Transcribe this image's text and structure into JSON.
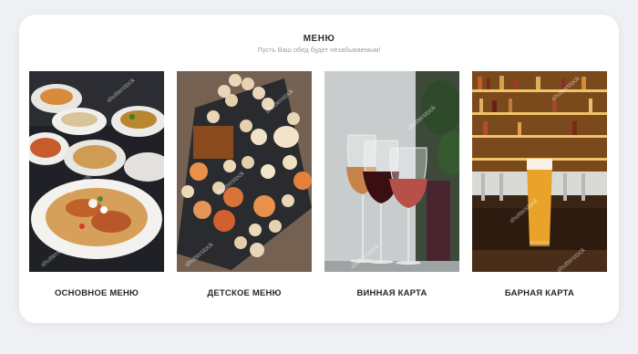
{
  "menu": {
    "title": "МЕНЮ",
    "subtitle": "Пусть Ваш обед будет незабываемым!"
  },
  "items": [
    {
      "label": "ОСНОВНОЕ МЕНЮ",
      "image": "main-dishes-photo"
    },
    {
      "label": "ДЕТСКОЕ МЕНЮ",
      "image": "kids-snacks-photo"
    },
    {
      "label": "ВИННАЯ КАРТА",
      "image": "wine-glasses-photo"
    },
    {
      "label": "БАРНАЯ КАРТА",
      "image": "beer-bar-photo"
    }
  ],
  "watermark": "shutterstock"
}
